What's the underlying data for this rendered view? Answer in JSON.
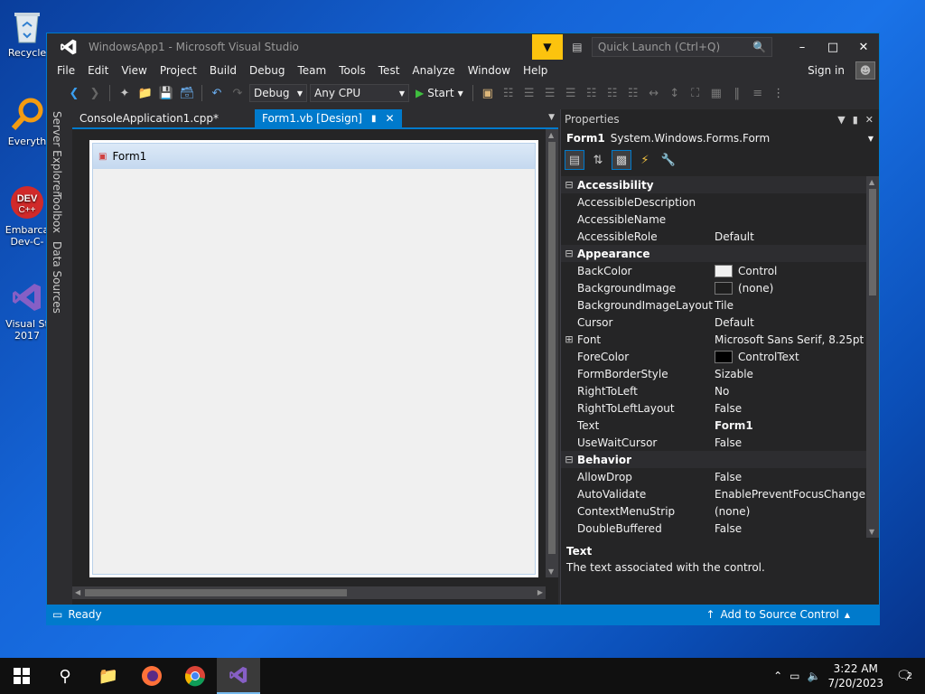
{
  "desktop": {
    "icons": [
      {
        "label": "Recycle",
        "icon": "recycle-bin-icon"
      },
      {
        "label": "Everyth",
        "icon": "everything-search-icon"
      },
      {
        "label": "Embarca",
        "label2": "Dev-C-",
        "icon": "devcpp-icon"
      },
      {
        "label": "Visual St",
        "label2": "2017",
        "icon": "visual-studio-icon"
      }
    ]
  },
  "window": {
    "title": "WindowsApp1 - Microsoft Visual Studio",
    "quick_launch_placeholder": "Quick Launch (Ctrl+Q)"
  },
  "menu": [
    "File",
    "Edit",
    "View",
    "Project",
    "Build",
    "Debug",
    "Team",
    "Tools",
    "Test",
    "Analyze",
    "Window",
    "Help"
  ],
  "signin": "Sign in",
  "toolbar": {
    "config": "Debug",
    "platform": "Any CPU",
    "start": "Start"
  },
  "side_tabs": [
    "Server Explorer",
    "Toolbox",
    "Data Sources"
  ],
  "doc_tabs": [
    {
      "label": "ConsoleApplication1.cpp*",
      "active": false
    },
    {
      "label": "Form1.vb [Design]",
      "active": true
    }
  ],
  "form": {
    "caption": "Form1"
  },
  "properties": {
    "header": "Properties",
    "object_name": "Form1",
    "object_type": "System.Windows.Forms.Form",
    "rows": [
      {
        "cat": true,
        "name": "Accessibility"
      },
      {
        "name": "AccessibleDescription",
        "value": ""
      },
      {
        "name": "AccessibleName",
        "value": ""
      },
      {
        "name": "AccessibleRole",
        "value": "Default"
      },
      {
        "cat": true,
        "name": "Appearance"
      },
      {
        "name": "BackColor",
        "value": "Control",
        "swatch": "#f0f0f0"
      },
      {
        "name": "BackgroundImage",
        "value": "(none)",
        "swatch": "#1e1e1e"
      },
      {
        "name": "BackgroundImageLayout",
        "value": "Tile"
      },
      {
        "name": "Cursor",
        "value": "Default"
      },
      {
        "name": "Font",
        "value": "Microsoft Sans Serif, 8.25pt",
        "expand": true
      },
      {
        "name": "ForeColor",
        "value": "ControlText",
        "swatch": "#000000"
      },
      {
        "name": "FormBorderStyle",
        "value": "Sizable"
      },
      {
        "name": "RightToLeft",
        "value": "No"
      },
      {
        "name": "RightToLeftLayout",
        "value": "False"
      },
      {
        "name": "Text",
        "value": "Form1",
        "bold": true
      },
      {
        "name": "UseWaitCursor",
        "value": "False"
      },
      {
        "cat": true,
        "name": "Behavior"
      },
      {
        "name": "AllowDrop",
        "value": "False"
      },
      {
        "name": "AutoValidate",
        "value": "EnablePreventFocusChange"
      },
      {
        "name": "ContextMenuStrip",
        "value": "(none)"
      },
      {
        "name": "DoubleBuffered",
        "value": "False"
      }
    ],
    "desc_title": "Text",
    "desc_text": "The text associated with the control."
  },
  "status": {
    "left": "Ready",
    "right": "Add to Source Control"
  },
  "taskbar": {
    "time": "3:22 AM",
    "date": "7/20/2023",
    "notifications": "2"
  },
  "colors": {
    "accent": "#007acc",
    "notify": "#fcc30e"
  }
}
